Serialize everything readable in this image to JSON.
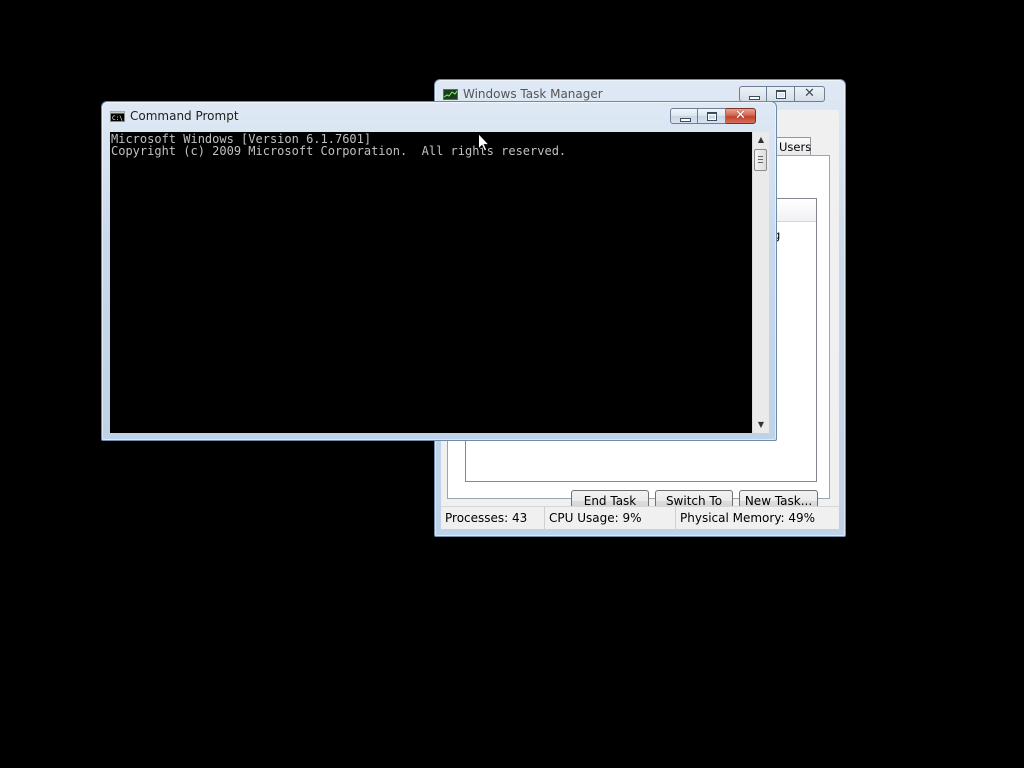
{
  "task_manager": {
    "title": "Windows Task Manager",
    "tab_visible_label": "Users",
    "list_cell_fragment": "g",
    "buttons": {
      "end_task": "End Task",
      "switch_to": "Switch To",
      "new_task": "New Task..."
    },
    "status": {
      "processes": "Processes: 43",
      "cpu_usage": "CPU Usage: 9%",
      "physical_memory": "Physical Memory: 49%"
    }
  },
  "command_prompt": {
    "title": "Command Prompt",
    "lines": [
      "Microsoft Windows [Version 6.1.7601]",
      "Copyright (c) 2009 Microsoft Corporation.  All rights reserved."
    ]
  },
  "icons": {
    "cmd_window_icon": "console-icon",
    "taskmgr_window_icon": "task-manager-icon",
    "minimize": "minimize-icon",
    "maximize": "maximize-icon",
    "close": "close-icon",
    "cursor": "arrow-cursor-icon"
  },
  "colors": {
    "desktop_background": "#000000",
    "console_background": "#000000",
    "console_text": "#c0c0c0",
    "close_button": "#c1412a"
  }
}
